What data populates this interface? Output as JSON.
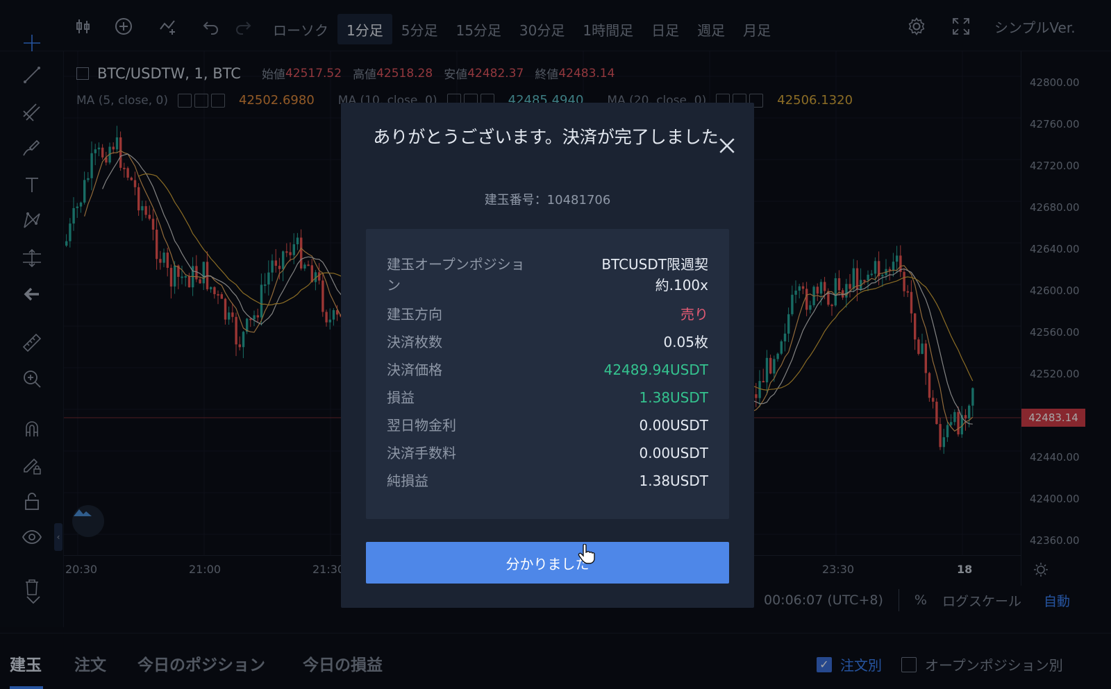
{
  "toolbar": {
    "timeframes": [
      "ローソク",
      "1分足",
      "5分足",
      "15分足",
      "30分足",
      "1時間足",
      "日足",
      "週足",
      "月足"
    ],
    "active_index": 1,
    "simple_ver": "シンプルVer."
  },
  "legend": {
    "symbol": "BTC/USDTW, 1, BTC",
    "open_label": "始値",
    "open": "42517.52",
    "high_label": "高値",
    "high": "42518.28",
    "low_label": "安値",
    "low": "42482.37",
    "close_label": "終値",
    "close": "42483.14",
    "ma1_label": "MA (5, close, 0)",
    "ma1_value": "42502.6980",
    "ma2_label": "MA (10, close, 0)",
    "ma2_value": "42485.4940",
    "ma3_label": "MA (20, close, 0)",
    "ma3_value": "42506.1320"
  },
  "colors": {
    "up": "#26a69a",
    "down": "#ef5350",
    "accent": "#4e87e8",
    "ma1": "#e0a45a",
    "ma3": "#d6a73a"
  },
  "yaxis": {
    "ticks": [
      "42800.00",
      "42760.00",
      "42720.00",
      "42680.00",
      "42640.00",
      "42600.00",
      "42560.00",
      "42520.00",
      "42480.00",
      "42440.00",
      "42400.00",
      "42360.00"
    ],
    "current_price": "42483.14"
  },
  "xaxis": {
    "ticks": [
      "20:30",
      "21:00",
      "21:30",
      "23:30",
      "18"
    ]
  },
  "bottom_info": {
    "time": "00:06:07 (UTC+8)",
    "percent": "%",
    "log_scale": "ログスケール",
    "auto": "自動"
  },
  "tabs": {
    "items": [
      "建玉",
      "注文",
      "今日のポジション",
      "今日の損益"
    ],
    "active_index": 0,
    "check_by_order": "注文別",
    "check_by_position": "オープンポジション別"
  },
  "modal": {
    "title": "ありがとうございます。決済が完了しました",
    "position_no": "建玉番号：10481706",
    "rows": [
      {
        "k": "建玉オープンポジション",
        "v": "BTCUSDT限週契約.100x"
      },
      {
        "k": "建玉方向",
        "v": "売り"
      },
      {
        "k": "決済枚数",
        "v": "0.05枚"
      },
      {
        "k": "決済価格",
        "v": "42489.94USDT"
      },
      {
        "k": "損益",
        "v": "1.38USDT"
      },
      {
        "k": "翌日物金利",
        "v": "0.00USDT"
      },
      {
        "k": "決済手数料",
        "v": "0.00USDT"
      },
      {
        "k": "純損益",
        "v": "1.38USDT"
      }
    ],
    "ok": "分かりました"
  }
}
